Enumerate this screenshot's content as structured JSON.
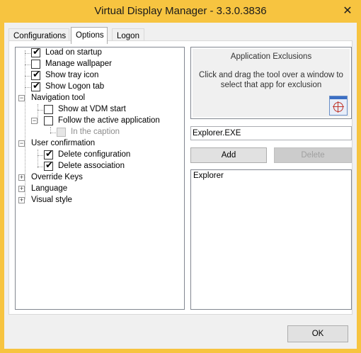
{
  "window": {
    "title": "Virtual Display Manager - 3.3.0.3836",
    "close_glyph": "✕"
  },
  "tabs": [
    {
      "label": "Configurations",
      "active": false
    },
    {
      "label": "Options",
      "active": true
    },
    {
      "label": "Logon",
      "active": false
    }
  ],
  "tree": {
    "items": [
      {
        "label": "Load on startup",
        "checked": true
      },
      {
        "label": "Manage wallpaper",
        "checked": false
      },
      {
        "label": "Show tray icon",
        "checked": true
      },
      {
        "label": "Show Logon tab",
        "checked": true
      },
      {
        "label": "Navigation tool",
        "expanded": true
      },
      {
        "label": "Show at VDM start",
        "checked": false
      },
      {
        "label": "Follow the active application",
        "checked": false,
        "expanded": true
      },
      {
        "label": "In the caption",
        "checked": false,
        "disabled": true
      },
      {
        "label": "User confirmation",
        "expanded": true
      },
      {
        "label": "Delete configuration",
        "checked": true
      },
      {
        "label": "Delete association",
        "checked": true
      },
      {
        "label": "Override Keys",
        "expanded": false
      },
      {
        "label": "Language",
        "expanded": false
      },
      {
        "label": "Visual style",
        "expanded": false
      }
    ],
    "expander_open": "−",
    "expander_closed": "+",
    "check_glyph": "✔"
  },
  "exclusions": {
    "title": "Application Exclusions",
    "description": "Click and drag the tool over a window to select that app for exclusion",
    "tool_icon": "crosshair-target-icon",
    "input_value": "Explorer.EXE",
    "add_label": "Add",
    "delete_label": "Delete",
    "list": [
      "Explorer"
    ]
  },
  "footer": {
    "ok_label": "OK"
  },
  "colors": {
    "title_bar": "#f7c440",
    "client_bg": "#f0f0f0",
    "tool_accent": "#c0352b"
  }
}
